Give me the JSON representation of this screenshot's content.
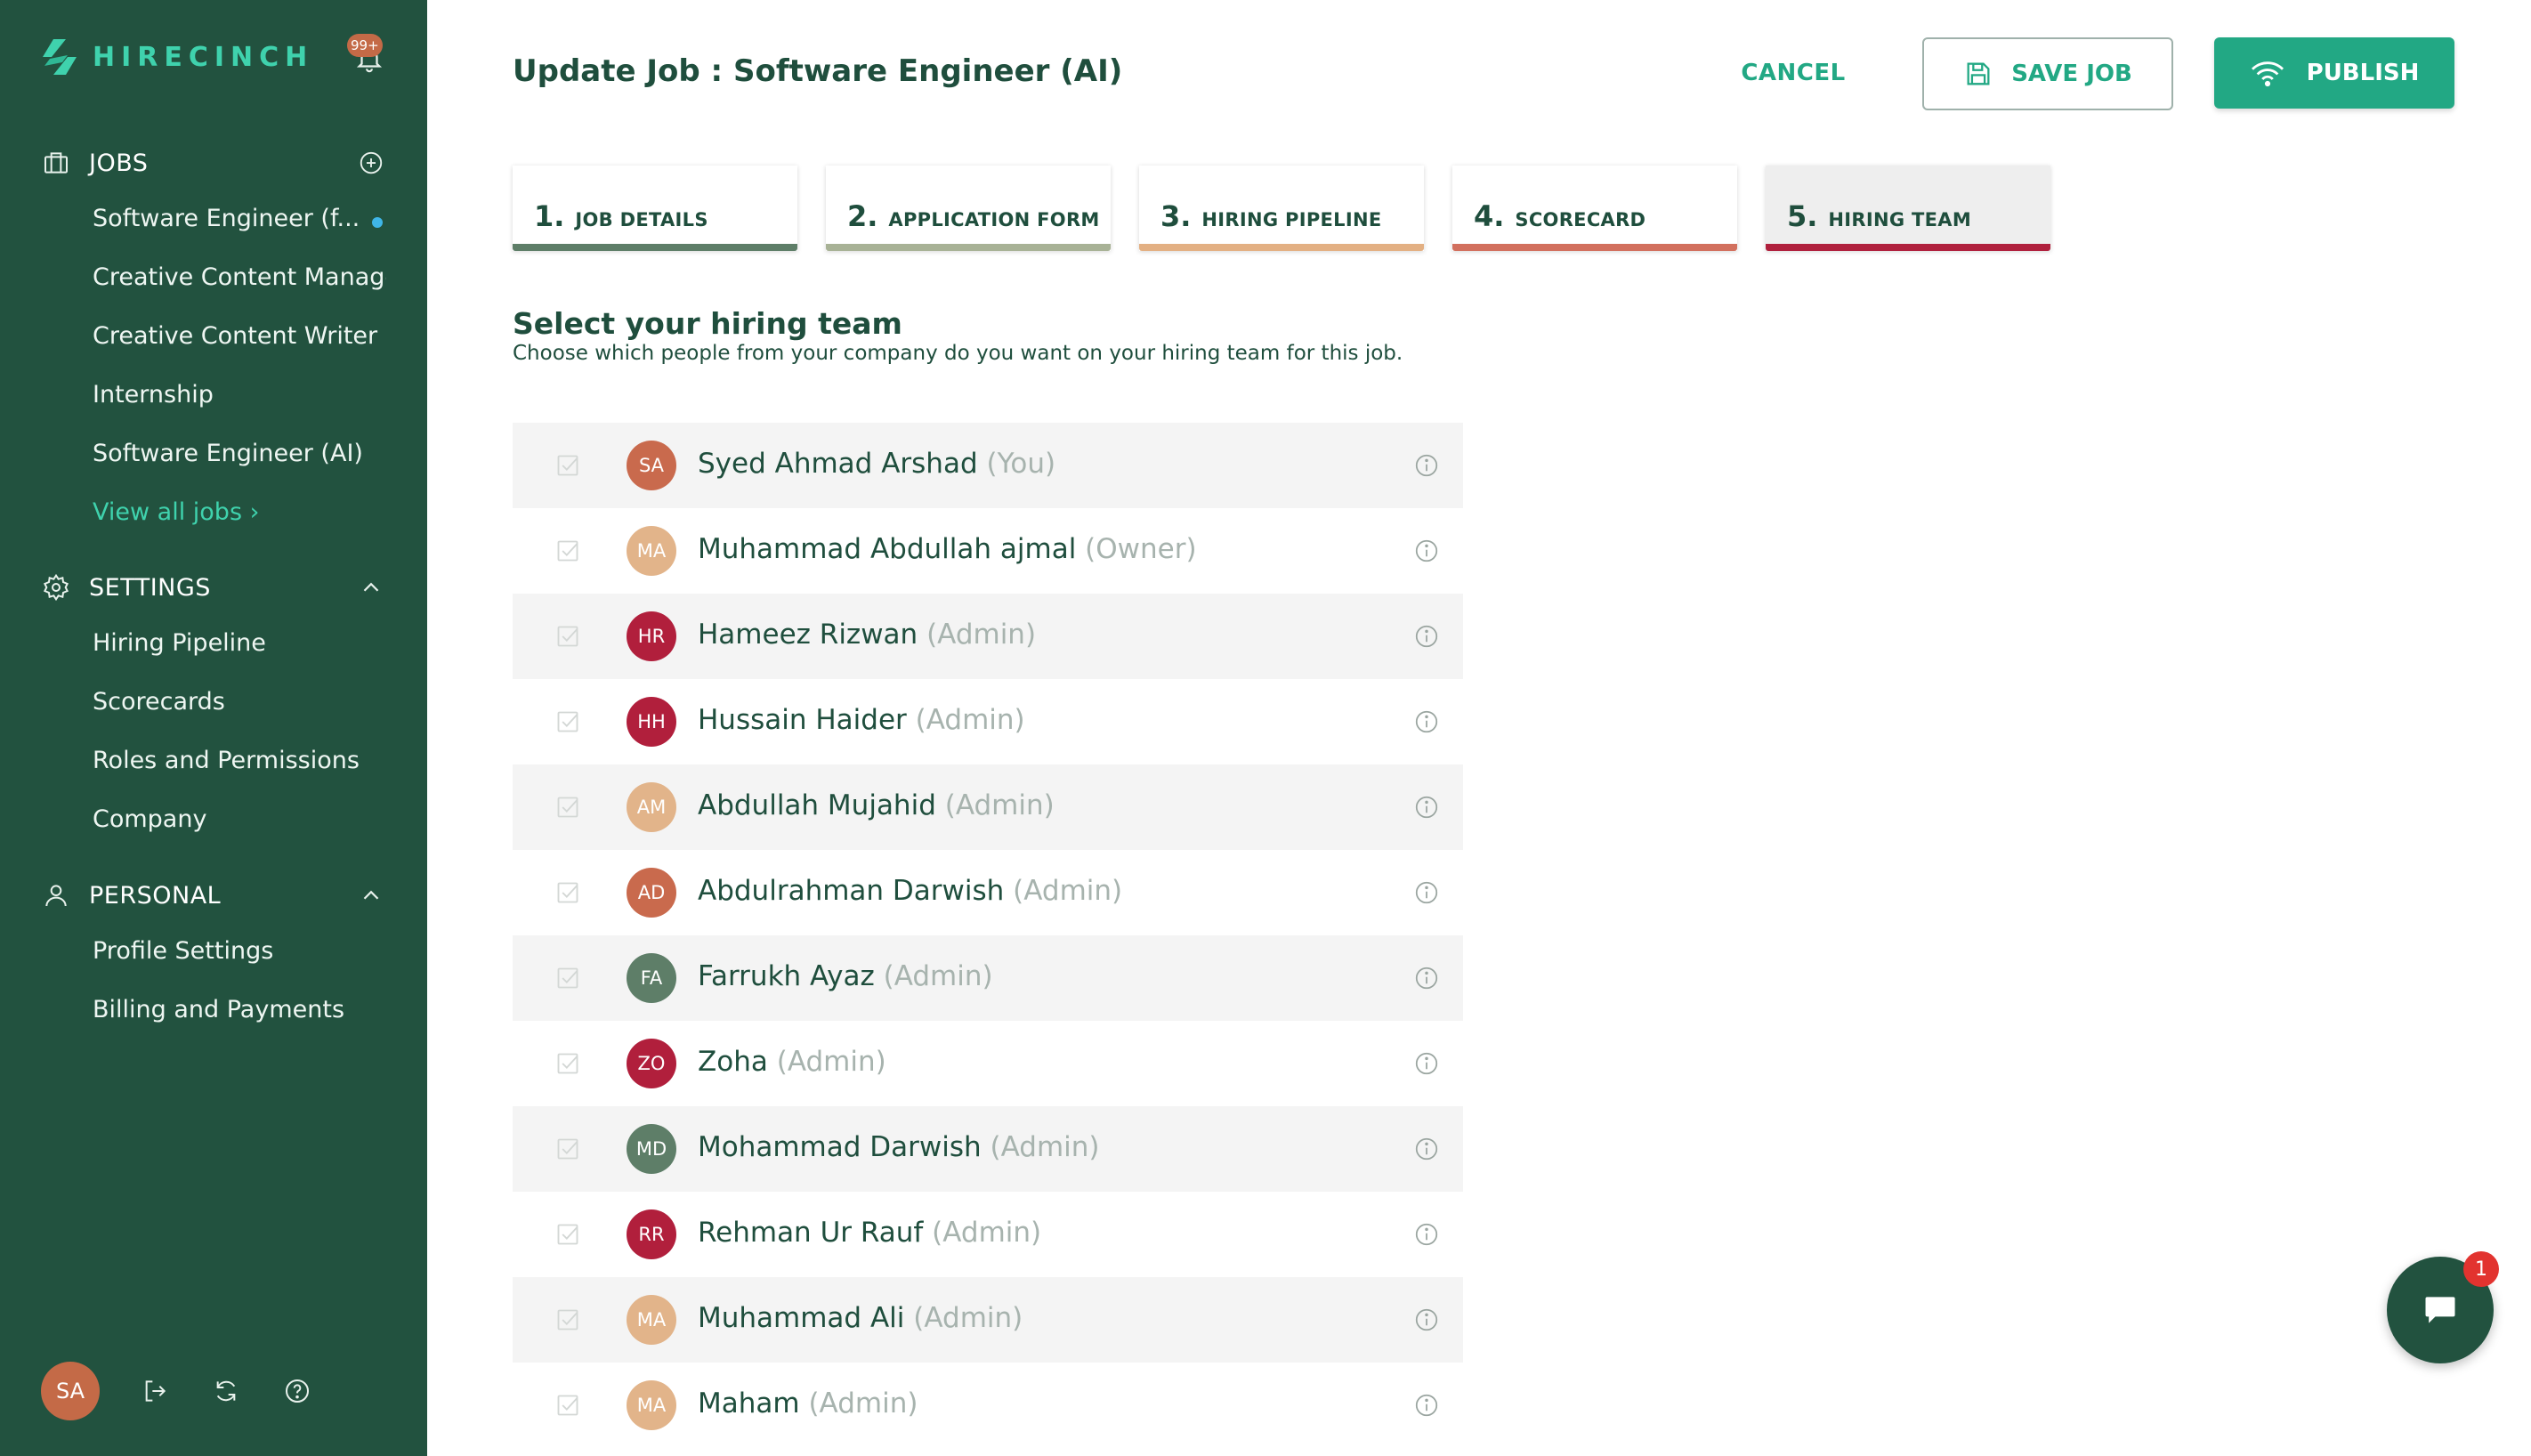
{
  "app": {
    "name": "HIRECINCH",
    "notifications_badge": "99+"
  },
  "sidebar": {
    "jobs": {
      "label": "JOBS",
      "items": [
        {
          "label": "Software Engineer (f...",
          "has_dot": true
        },
        {
          "label": "Creative Content Manager"
        },
        {
          "label": "Creative Content Writer"
        },
        {
          "label": "Internship"
        },
        {
          "label": "Software Engineer (AI)"
        }
      ],
      "view_all": "View all jobs ›"
    },
    "settings": {
      "label": "SETTINGS",
      "items": [
        {
          "label": "Hiring Pipeline"
        },
        {
          "label": "Scorecards"
        },
        {
          "label": "Roles and Permissions"
        },
        {
          "label": "Company"
        }
      ]
    },
    "personal": {
      "label": "PERSONAL",
      "items": [
        {
          "label": "Profile Settings"
        },
        {
          "label": "Billing and Payments"
        }
      ]
    },
    "footer": {
      "avatar_initials": "SA"
    }
  },
  "header": {
    "title": "Update Job : Software Engineer (AI)",
    "cancel_label": "CANCEL",
    "save_label": "SAVE JOB",
    "publish_label": "PUBLISH"
  },
  "steps": [
    {
      "num": "1.",
      "label": "JOB DETAILS",
      "color": "#5e7e68"
    },
    {
      "num": "2.",
      "label": "APPLICATION FORM",
      "color": "#a8b296"
    },
    {
      "num": "3.",
      "label": "HIRING PIPELINE",
      "color": "#e3b083"
    },
    {
      "num": "4.",
      "label": "SCORECARD",
      "color": "#d2705e"
    },
    {
      "num": "5.",
      "label": "HIRING TEAM",
      "color": "#b0203d",
      "active": true
    }
  ],
  "section": {
    "title": "Select your hiring team",
    "subtitle": "Choose which people from your company do you want on your hiring team for this job."
  },
  "team": [
    {
      "initials": "SA",
      "name": "Syed Ahmad Arshad",
      "role": "(You)",
      "avatar_color": "#c96a4d"
    },
    {
      "initials": "MA",
      "name": "Muhammad Abdullah ajmal",
      "role": "(Owner)",
      "avatar_color": "#e2b48a"
    },
    {
      "initials": "HR",
      "name": "Hameez Rizwan",
      "role": "(Admin)",
      "avatar_color": "#b11f3c"
    },
    {
      "initials": "HH",
      "name": "Hussain Haider",
      "role": "(Admin)",
      "avatar_color": "#b11f3c"
    },
    {
      "initials": "AM",
      "name": "Abdullah Mujahid",
      "role": "(Admin)",
      "avatar_color": "#e2b48a"
    },
    {
      "initials": "AD",
      "name": "Abdulrahman Darwish",
      "role": "(Admin)",
      "avatar_color": "#c96a4d"
    },
    {
      "initials": "FA",
      "name": "Farrukh Ayaz",
      "role": "(Admin)",
      "avatar_color": "#5e7e68"
    },
    {
      "initials": "ZO",
      "name": "Zoha",
      "role": "(Admin)",
      "avatar_color": "#b11f3c"
    },
    {
      "initials": "MD",
      "name": "Mohammad Darwish",
      "role": "(Admin)",
      "avatar_color": "#5e7e68"
    },
    {
      "initials": "RR",
      "name": "Rehman Ur Rauf",
      "role": "(Admin)",
      "avatar_color": "#b11f3c"
    },
    {
      "initials": "MA",
      "name": "Muhammad Ali",
      "role": "(Admin)",
      "avatar_color": "#e2b48a"
    },
    {
      "initials": "MA",
      "name": "Maham",
      "role": "(Admin)",
      "avatar_color": "#e2b48a"
    }
  ],
  "chat": {
    "badge": "1"
  },
  "colors": {
    "sidebar_bg": "#22523f",
    "accent": "#22a884",
    "logo": "#3fd2ad"
  }
}
